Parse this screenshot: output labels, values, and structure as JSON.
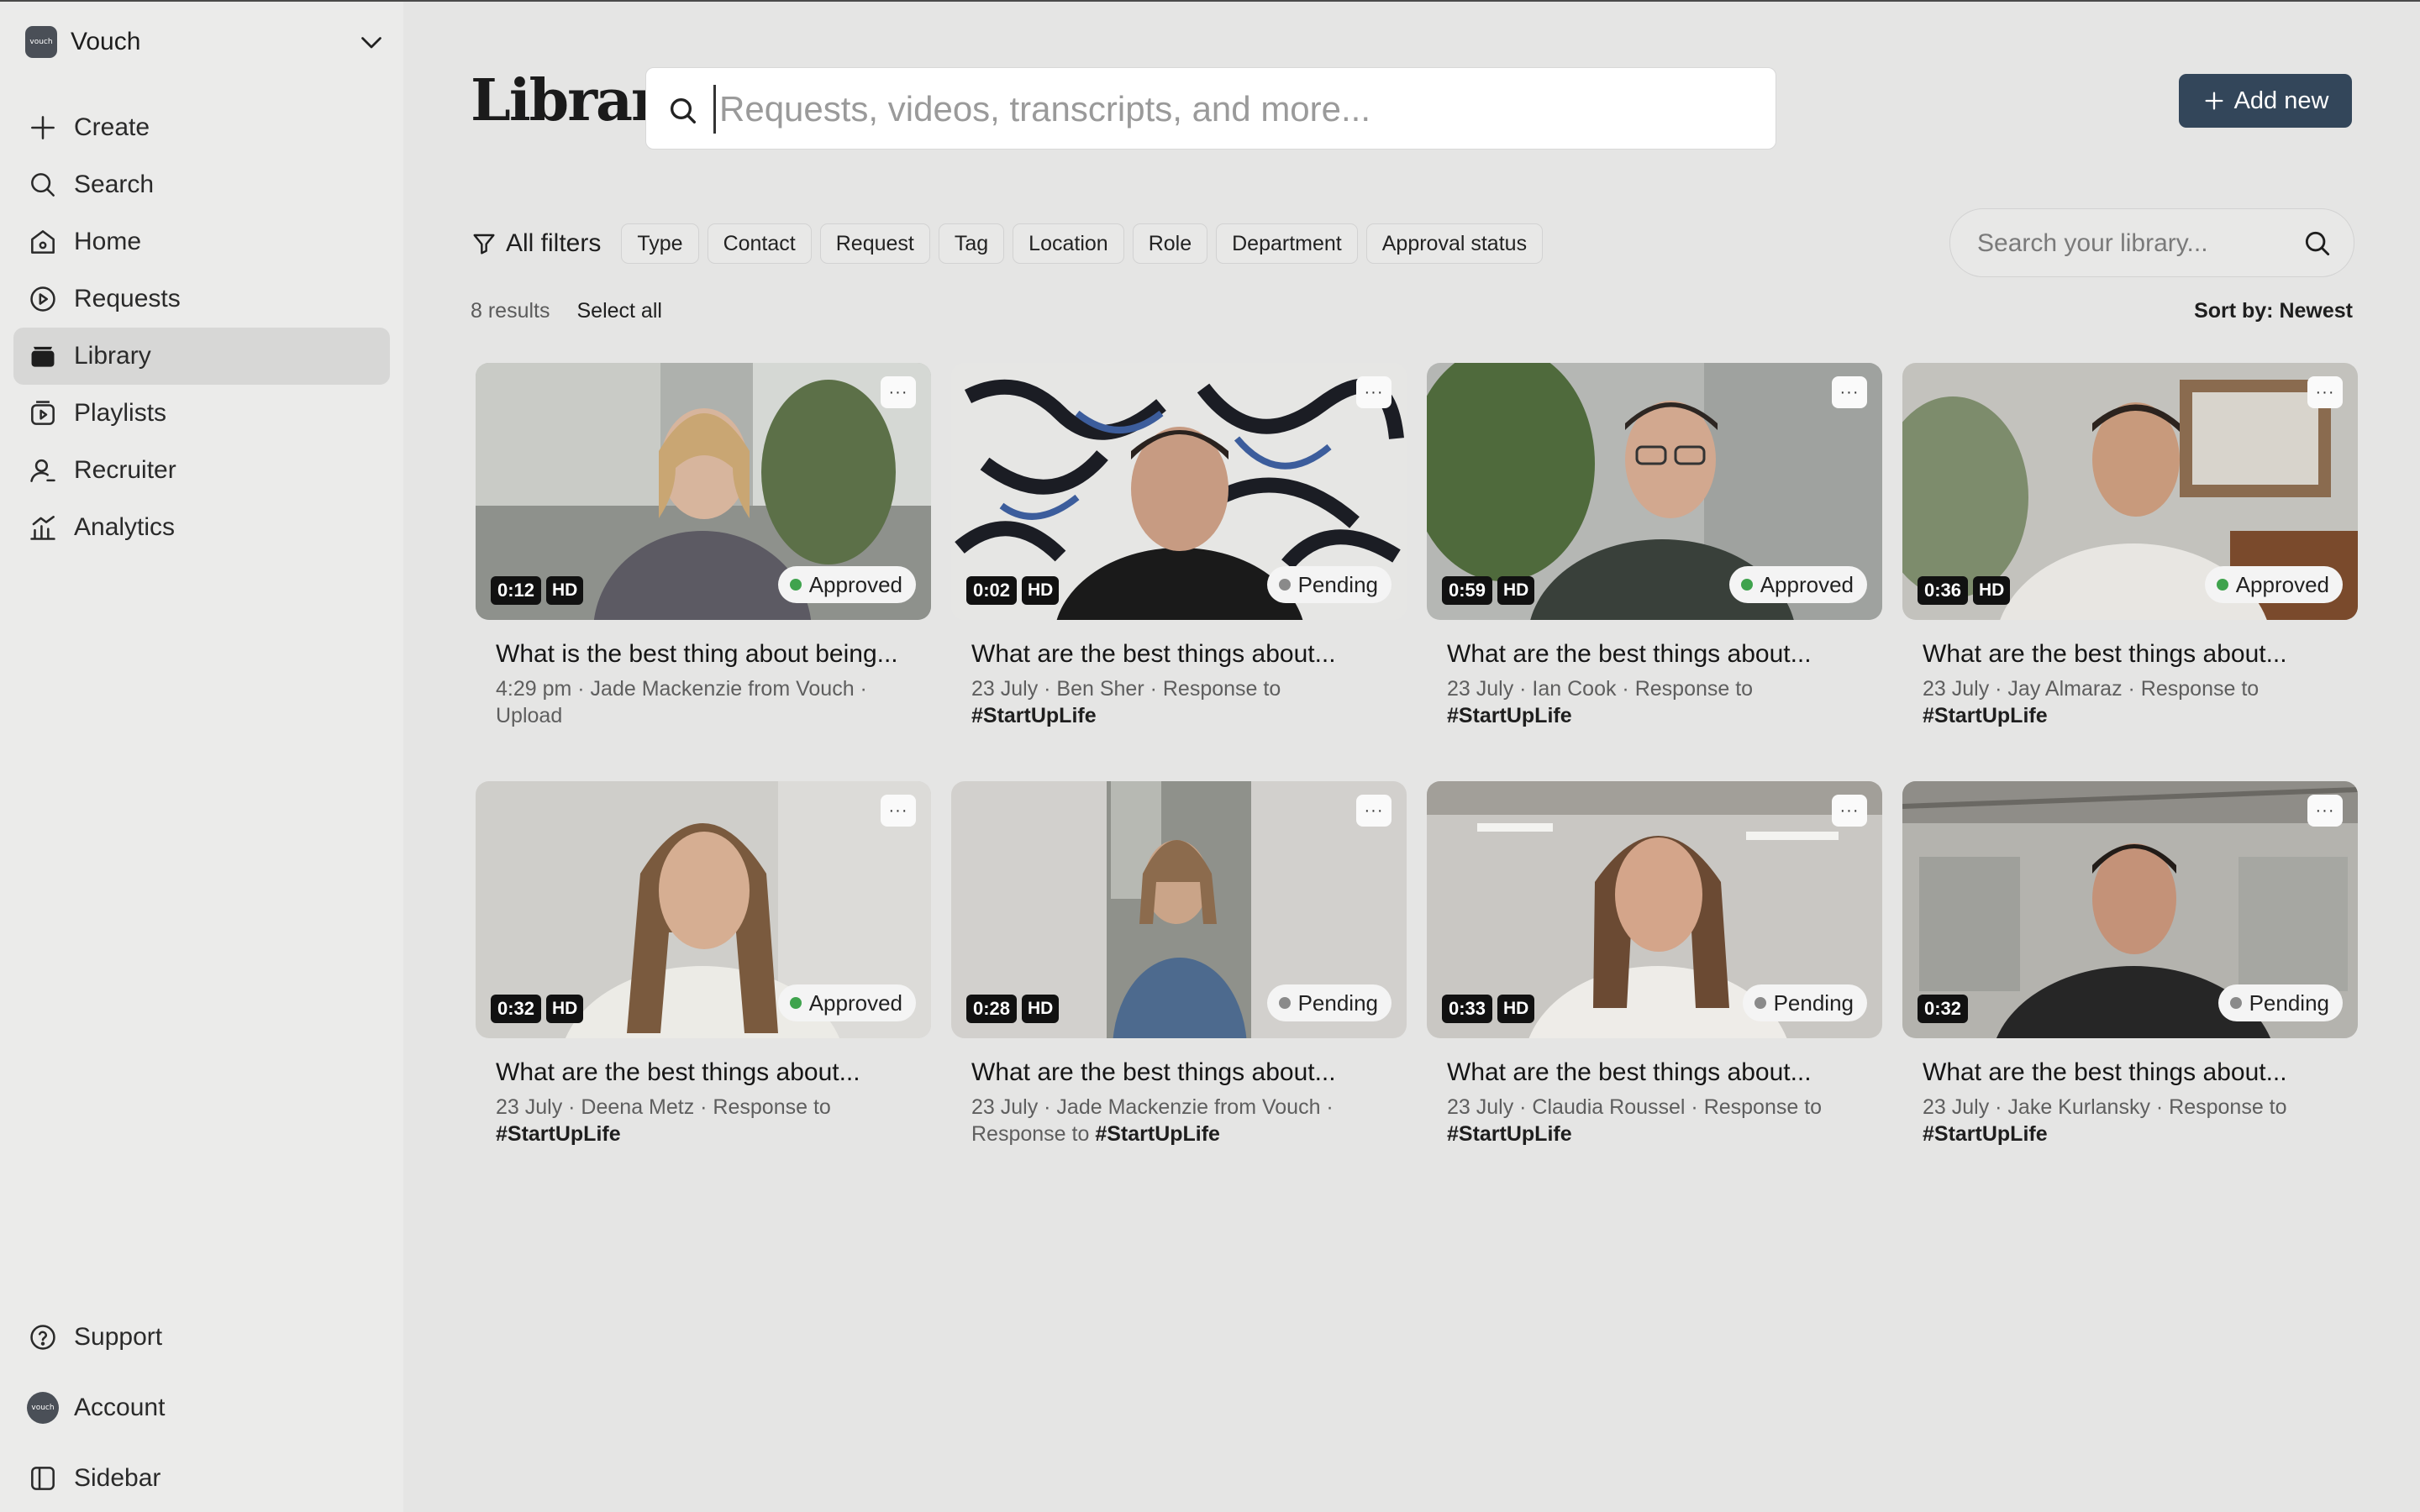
{
  "sidebar": {
    "workspace_name": "Vouch",
    "workspace_logo_text": "vouch",
    "nav": [
      {
        "label": "Create",
        "icon": "plus-icon"
      },
      {
        "label": "Search",
        "icon": "search-icon"
      },
      {
        "label": "Home",
        "icon": "home-icon"
      },
      {
        "label": "Requests",
        "icon": "play-circle-icon"
      },
      {
        "label": "Library",
        "icon": "library-icon",
        "active": true
      },
      {
        "label": "Playlists",
        "icon": "playlist-icon"
      },
      {
        "label": "Recruiter",
        "icon": "user-icon"
      },
      {
        "label": "Analytics",
        "icon": "analytics-icon"
      }
    ],
    "bottom": {
      "support": "Support",
      "account": "Account",
      "avatar_text": "vouch",
      "sidebar": "Sidebar"
    }
  },
  "header": {
    "title": "Library",
    "search_placeholder": "Requests, videos, transcripts, and more...",
    "add_new": "Add new"
  },
  "filters": {
    "all_filters": "All filters",
    "chips": [
      "Type",
      "Contact",
      "Request",
      "Tag",
      "Location",
      "Role",
      "Department",
      "Approval status"
    ],
    "library_search_placeholder": "Search your library..."
  },
  "results": {
    "count": "8 results",
    "select_all": "Select all",
    "sort": "Sort by: Newest"
  },
  "colors": {
    "approved": "#3fa34d",
    "pending": "#8a8a8a",
    "primary_button": "#33465a"
  },
  "cards": [
    {
      "duration": "0:12",
      "hd": "HD",
      "status": "Approved",
      "title": "What is the best thing about being...",
      "meta": "4:29 pm · Jade Mackenzie from Vouch · Upload",
      "meta_tag": ""
    },
    {
      "duration": "0:02",
      "hd": "HD",
      "status": "Pending",
      "title": "What are the best things about...",
      "meta": "23 July · Ben Sher · Response to",
      "meta_tag": "#StartUpLife"
    },
    {
      "duration": "0:59",
      "hd": "HD",
      "status": "Approved",
      "title": "What are the best things about...",
      "meta": "23 July · Ian Cook · Response to",
      "meta_tag": "#StartUpLife"
    },
    {
      "duration": "0:36",
      "hd": "HD",
      "status": "Approved",
      "title": "What are the best things about...",
      "meta": "23 July · Jay Almaraz · Response to",
      "meta_tag": "#StartUpLife"
    },
    {
      "duration": "0:32",
      "hd": "HD",
      "status": "Approved",
      "title": "What are the best things about...",
      "meta": "23 July · Deena Metz · Response to",
      "meta_tag": "#StartUpLife"
    },
    {
      "duration": "0:28",
      "hd": "HD",
      "status": "Pending",
      "title": "What are the best things about...",
      "meta": "23 July · Jade Mackenzie from Vouch · Response to",
      "meta_tag": "#StartUpLife"
    },
    {
      "duration": "0:33",
      "hd": "HD",
      "status": "Pending",
      "title": "What are the best things about...",
      "meta": "23 July · Claudia Roussel · Response to",
      "meta_tag": "#StartUpLife"
    },
    {
      "duration": "0:32",
      "hd": "",
      "status": "Pending",
      "title": "What are the best things about...",
      "meta": "23 July · Jake Kurlansky · Response to",
      "meta_tag": "#StartUpLife"
    }
  ]
}
